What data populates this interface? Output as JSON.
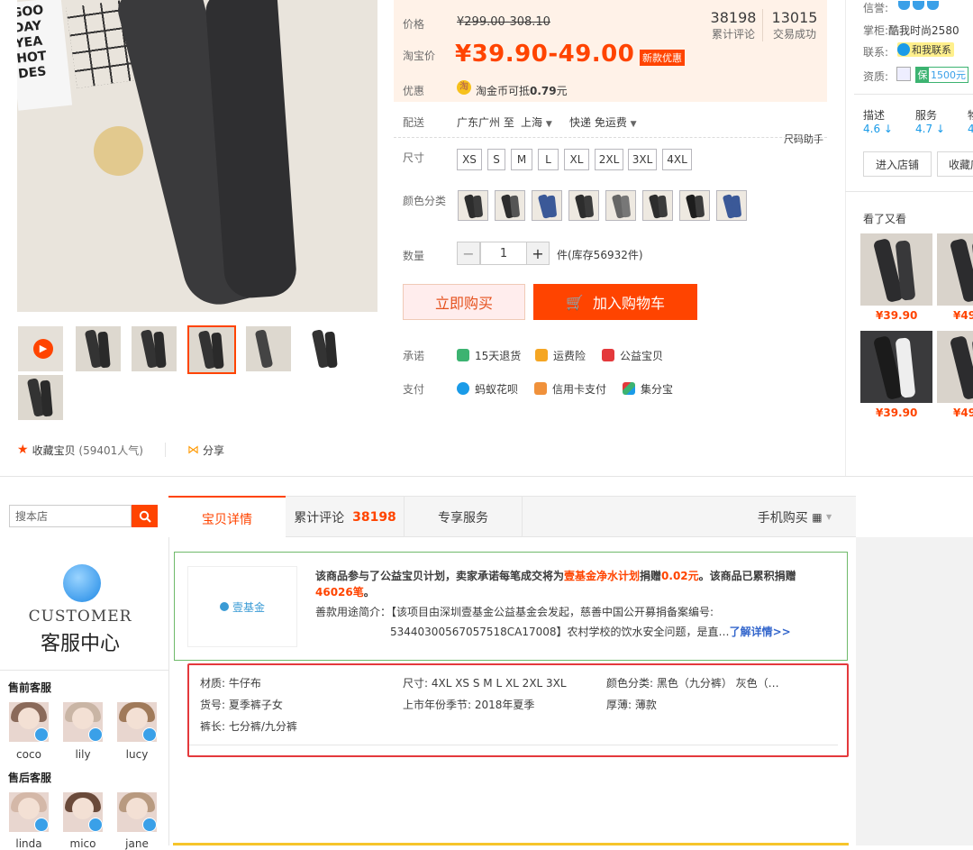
{
  "gallery": {
    "main_image_alt": "jeans photo",
    "paper_text": "GOO\nDAY\nYEA\nHOT\nDES"
  },
  "favorite": {
    "label": "收藏宝贝",
    "count": "(59401人气)"
  },
  "share": {
    "label": "分享"
  },
  "price": {
    "price_label": "价格",
    "original": "¥299.00-308.10",
    "taobao_label": "淘宝价",
    "current": "¥39.90-49.00",
    "badge": "新款优惠",
    "reviews_count": "38198",
    "reviews_label": "累计评论",
    "sales_count": "13015",
    "sales_label": "交易成功",
    "promo_label": "优惠",
    "promo_text_prefix": "淘金币可抵",
    "promo_amount": "0.79",
    "promo_unit": "元"
  },
  "delivery": {
    "label": "配送",
    "from": "广东广州 至",
    "to": "上海",
    "method": "快递 免运费",
    "size_helper": "尺码助手"
  },
  "size": {
    "label": "尺寸",
    "options": [
      "XS",
      "S",
      "M",
      "L",
      "XL",
      "2XL",
      "3XL",
      "4XL"
    ]
  },
  "color": {
    "label": "颜色分类"
  },
  "quantity": {
    "label": "数量",
    "value": "1",
    "stock": "件(库存56932件)",
    "minus": "−",
    "plus": "+"
  },
  "actions": {
    "buy": "立即购买",
    "cart": "加入购物车"
  },
  "promise": {
    "label": "承诺",
    "items": [
      "15天退货",
      "运费险",
      "公益宝贝"
    ]
  },
  "payment": {
    "label": "支付",
    "items": [
      "蚂蚁花呗",
      "信用卡支付",
      "集分宝"
    ]
  },
  "shop": {
    "credit_label": "信誉:",
    "keeper_label": "掌柜:",
    "keeper_name": "酷我时尚2580",
    "contact_label": "联系:",
    "contact_btn": "和我联系",
    "qual_label": "资质:",
    "qual_value": "1500元",
    "ratings": [
      {
        "label": "描述",
        "value": "4.6"
      },
      {
        "label": "服务",
        "value": "4.7"
      },
      {
        "label": "物",
        "value": "4"
      }
    ],
    "enter_btn": "进入店铺",
    "collect_btn": "收藏店",
    "also_viewed": "看了又看",
    "recs": [
      "¥39.90",
      "¥49",
      "¥39.90",
      "¥49"
    ]
  },
  "store_search": {
    "placeholder": "搜本店"
  },
  "tabs": [
    {
      "label": "宝贝详情"
    },
    {
      "label": "累计评论",
      "count": "38198"
    },
    {
      "label": "专享服务"
    }
  ],
  "mobile_buy": "手机购买",
  "customer_service": {
    "logo_en": "CUSTOMER",
    "logo_cn": "客服中心",
    "presale_title": "售前客服",
    "presale": [
      "coco",
      "lily",
      "lucy"
    ],
    "aftersale_title": "售后客服",
    "aftersale": [
      "linda",
      "mico",
      "jane"
    ]
  },
  "charity": {
    "logo_text": "壹基金",
    "line1_a": "该商品参与了公益宝贝计划，卖家承诺每笔成交将为",
    "line1_org": "壹基金净水计划",
    "line1_b": "捐赠",
    "line1_amt": "0.02元",
    "line1_c": "。该商品已累积捐赠",
    "line2_amt": "46026笔",
    "line2_end": "。",
    "purpose_label": "善款用途简介：",
    "purpose_text": "【该项目由深圳壹基金公益基金会发起，慈善中国公开募捐备案编号:",
    "purpose_text2": "53440300567057518CA17008】农村学校的饮水安全问题，是直…",
    "more_link": "了解详情>>"
  },
  "attributes": [
    "材质: 牛仔布",
    "尺寸: 4XL XS S M L XL 2XL 3XL",
    "颜色分类: 黑色（九分裤） 灰色（…",
    "货号: 夏季裤子女",
    "上市年份季节: 2018年夏季",
    "厚薄: 薄款",
    "裤长: 七分裤/九分裤"
  ],
  "colors": {
    "accent": "#ff4400",
    "price_bg": "#fff2e8",
    "highlight_border": "#e4393c"
  }
}
